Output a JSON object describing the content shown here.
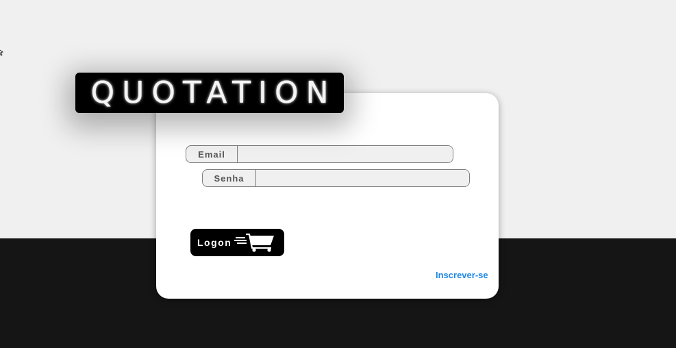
{
  "brand": {
    "title": "QUOTATION"
  },
  "login_form": {
    "email": {
      "label": "Email",
      "value": "",
      "placeholder": ""
    },
    "password": {
      "label": "Senha",
      "value": "",
      "placeholder": ""
    },
    "submit_label": "Logon",
    "submit_icon": "shopping-cart-icon",
    "signup_link": "Inscrever-se"
  },
  "colors": {
    "background": "#f0f0f0",
    "dark_band": "#151515",
    "card": "#ffffff",
    "brand_badge": "#000000",
    "link": "#1e88e5"
  }
}
